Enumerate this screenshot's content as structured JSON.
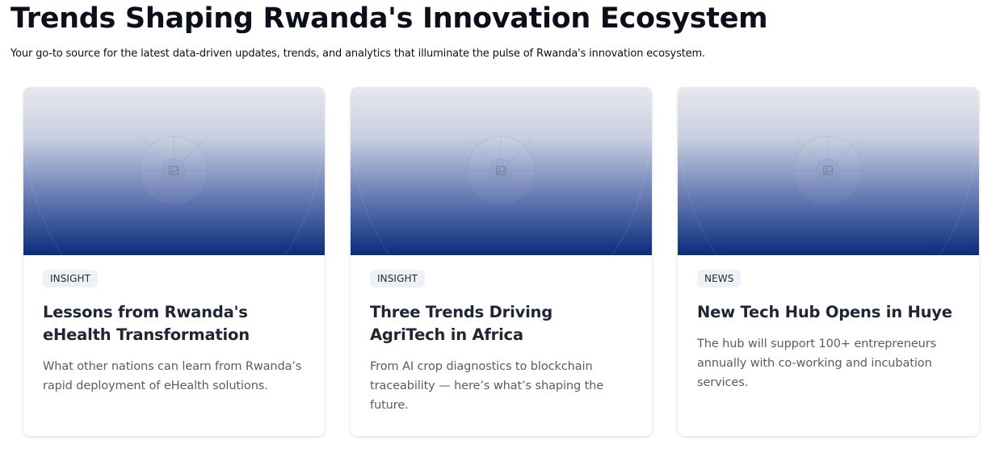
{
  "header": {
    "title": "Trends Shaping Rwanda's Innovation Ecosystem",
    "subtitle": "Your go-to source for the latest data-driven updates, trends, and analytics that illuminate the pulse of Rwanda's innovation ecosystem."
  },
  "cards": [
    {
      "image_icon": "image-placeholder-icon",
      "tag": "INSIGHT",
      "title": "Lessons from Rwanda's eHealth Transformation",
      "description": "What other nations can learn from Rwanda’s rapid deployment of eHealth solutions."
    },
    {
      "image_icon": "image-placeholder-icon",
      "tag": "INSIGHT",
      "title": "Three Trends Driving AgriTech in Africa",
      "description": "From AI crop diagnostics to blockchain traceability — here’s what’s shaping the future."
    },
    {
      "image_icon": "image-placeholder-icon",
      "tag": "NEWS",
      "title": "New Tech Hub Opens in Huye",
      "description": "The hub will support 100+ entrepreneurs annually with co-working and incubation services."
    }
  ],
  "colors": {
    "title": "#0b0f19",
    "image_gradient_top": "#e7e8ee",
    "image_gradient_bottom": "#0a2c7c",
    "badge_bg": "#eef1f6",
    "card_title": "#1e2533",
    "card_desc": "#555d6b"
  }
}
